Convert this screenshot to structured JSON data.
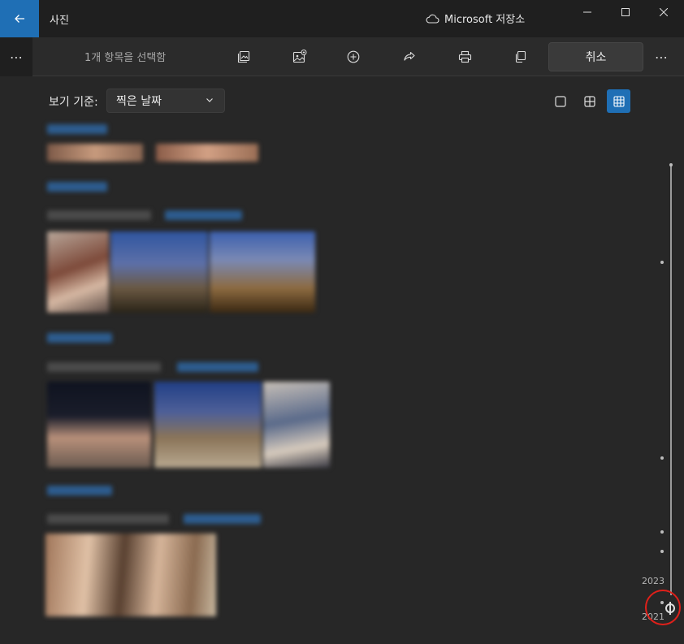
{
  "titlebar": {
    "app_title": "사진",
    "store_label": "Microsoft 저장소"
  },
  "toolbar": {
    "selected_text": "1개 항목을 선택함",
    "cancel_label": "취소",
    "more_label": "⋯",
    "left_more_label": "⋯"
  },
  "view": {
    "label": "보기 기준:",
    "selected_option": "찍은 날짜"
  },
  "timeline": {
    "years": [
      "2023",
      "2021"
    ]
  },
  "colors": {
    "accent": "#1f6fb5",
    "background": "#272727",
    "annotation": "#e0201a"
  }
}
